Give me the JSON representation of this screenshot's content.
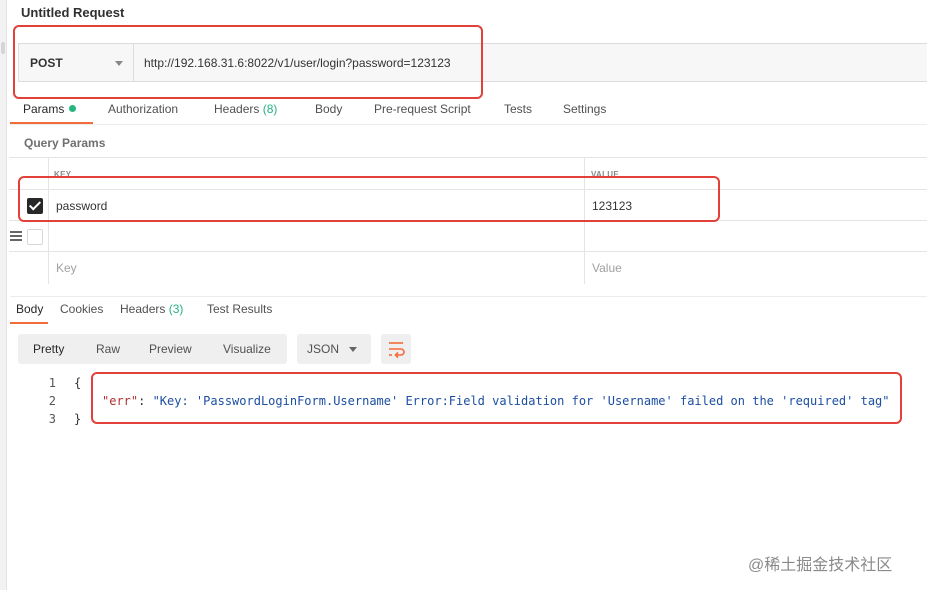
{
  "request": {
    "title": "Untitled Request",
    "method": "POST",
    "url": "http://192.168.31.6:8022/v1/user/login?password=123123"
  },
  "request_tabs": [
    {
      "label": "Params",
      "has_dot": true
    },
    {
      "label": "Authorization"
    },
    {
      "label": "Headers",
      "count": "(8)"
    },
    {
      "label": "Body"
    },
    {
      "label": "Pre-request Script"
    },
    {
      "label": "Tests"
    },
    {
      "label": "Settings"
    }
  ],
  "query_params": {
    "title": "Query Params",
    "key_header": "KEY",
    "value_header": "VALUE",
    "rows": [
      {
        "key": "password",
        "value": "123123",
        "checked": true
      }
    ],
    "key_placeholder": "Key",
    "value_placeholder": "Value"
  },
  "response_tabs": [
    {
      "label": "Body"
    },
    {
      "label": "Cookies"
    },
    {
      "label": "Headers",
      "count": "(3)"
    },
    {
      "label": "Test Results"
    }
  ],
  "view_modes": [
    "Pretty",
    "Raw",
    "Preview",
    "Visualize"
  ],
  "format": "JSON",
  "body_lines": {
    "numbers": [
      "1",
      "2",
      "3"
    ],
    "open_brace": "{",
    "key": "\"err\"",
    "colon": ": ",
    "value": "\"Key: 'PasswordLoginForm.Username' Error:Field validation for 'Username' failed on the 'required' tag\"",
    "close_brace": "}"
  },
  "watermark": "@稀土掘金技术社区",
  "colors": {
    "accent": "#f26b3a",
    "highlight": "#e2413a",
    "dot_green": "#26b47f"
  }
}
